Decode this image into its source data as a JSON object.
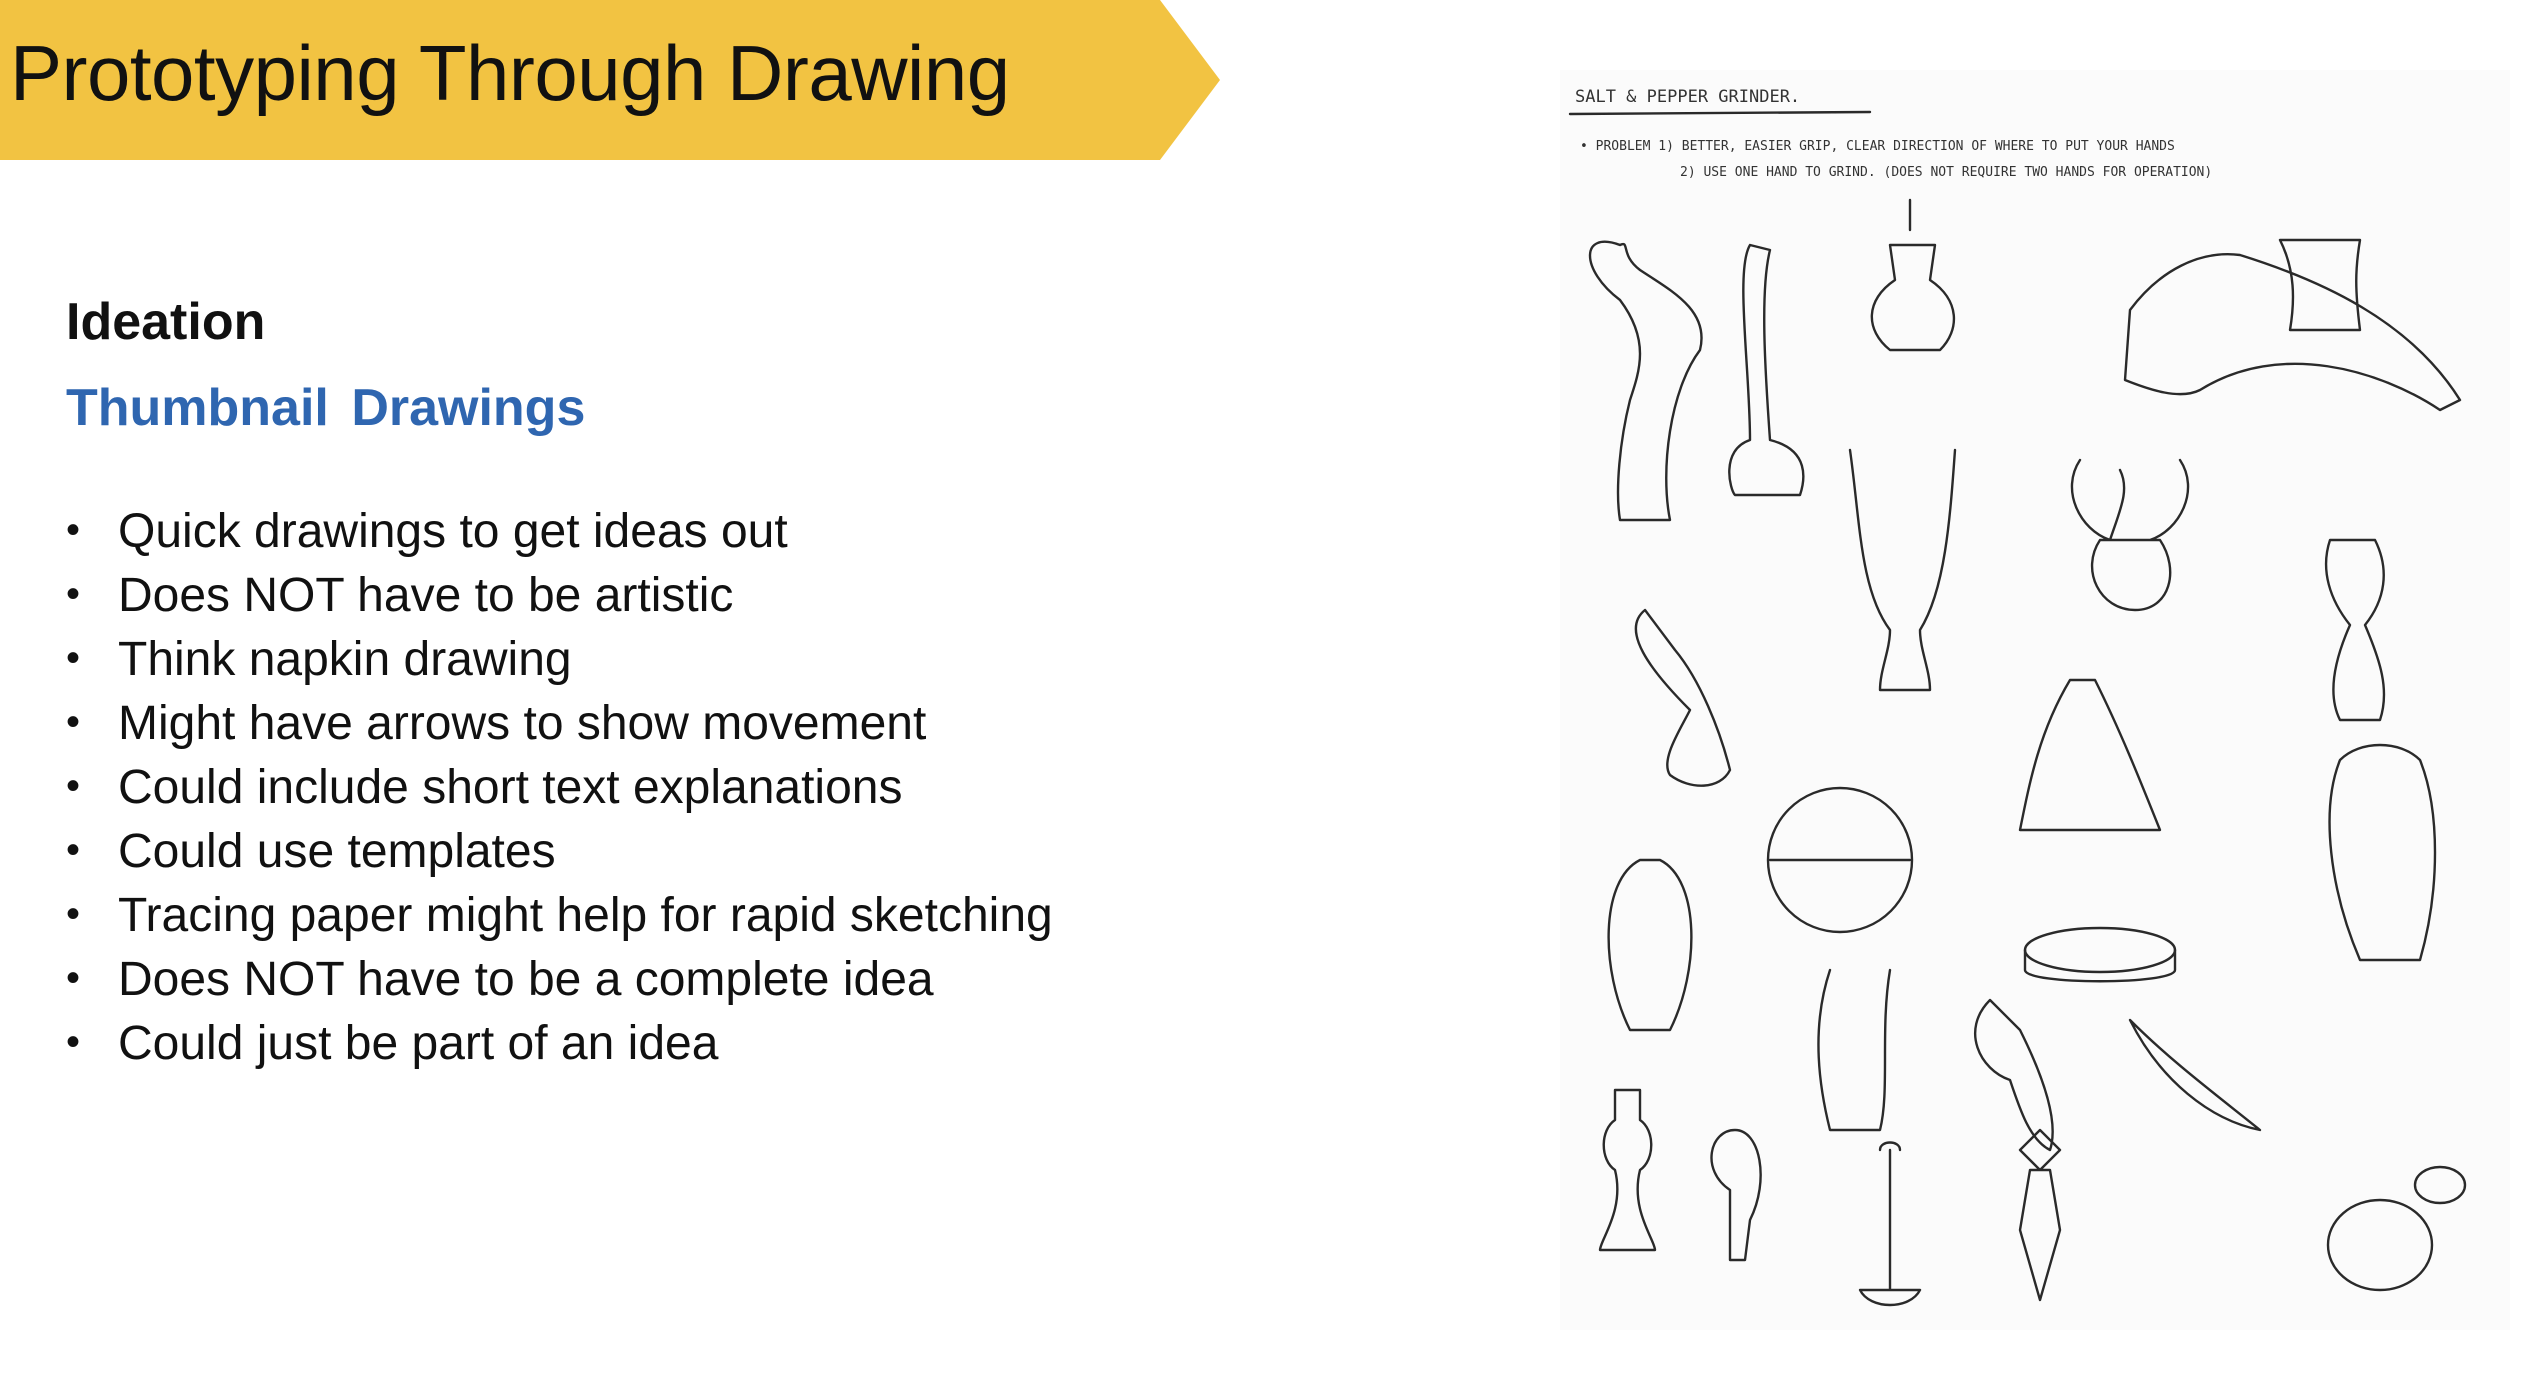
{
  "title": "Prototyping Through Drawing",
  "heading": "Ideation",
  "subheading": "Thumbnail Drawings",
  "bullets": [
    "Quick drawings to get ideas out",
    "Does NOT have to be artistic",
    "Think napkin drawing",
    "Might have arrows to show movement",
    "Could include short text explanations",
    "Could use templates",
    "Tracing paper might help for rapid sketching",
    "Does NOT have to be a complete idea",
    "Could just be part of an idea"
  ],
  "sketch": {
    "title": "SALT & PEPPER GRINDER.",
    "problem_line1": "• PROBLEM 1) BETTER, EASIER GRIP, CLEAR DIRECTION OF WHERE TO PUT YOUR HANDS",
    "problem_line2": "2) USE ONE HAND TO GRIND. (DOES NOT REQUIRE TWO HANDS FOR OPERATION)"
  },
  "colors": {
    "banner": "#F2C342",
    "accent_blue": "#2F66B0",
    "text": "#111111"
  }
}
